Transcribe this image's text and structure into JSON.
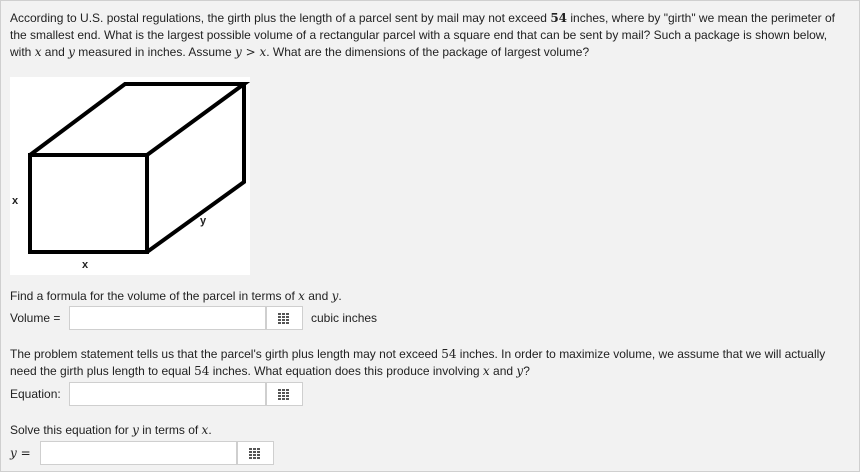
{
  "intro": {
    "t1": "According to U.S. postal regulations, the girth plus the length of a parcel sent by mail may not exceed ",
    "n1": "54",
    "t2": " inches, where by \"girth\" we mean the perimeter of the smallest end. What is the largest possible volume of a rectangular parcel with a square end that can be sent by mail? Such a package is shown below, with ",
    "x": "x",
    "t3": " and ",
    "y": "y",
    "t4": " measured in inches. Assume ",
    "cmp": "y > x",
    "t5": ". What are the dimensions of the package of largest volume?"
  },
  "figure": {
    "label_x_side": "x",
    "label_x_bottom": "x",
    "label_y": "y"
  },
  "q1": {
    "prompt_a": "Find a formula for the volume of the parcel in terms of ",
    "x": "x",
    "mid": " and ",
    "y": "y",
    "end": ".",
    "field_label": "Volume =",
    "value": "",
    "unit": "cubic inches",
    "grid_icon": "grid-icon"
  },
  "q2": {
    "t1": "The problem statement tells us that the parcel's girth plus length may not exceed ",
    "n1": "54",
    "t2": " inches. In order to maximize volume, we assume that we will actually need the girth plus length to equal ",
    "n2": "54",
    "t3": " inches. What equation does this produce involving ",
    "x": "x",
    "mid": " and ",
    "y": "y",
    "end": "?",
    "field_label": "Equation:",
    "value": "",
    "grid_icon": "grid-icon"
  },
  "q3": {
    "prompt_a": "Solve this equation for ",
    "y": "y",
    "mid": " in terms of ",
    "x": "x",
    "end": ".",
    "field_label": "y =",
    "value": "",
    "grid_icon": "grid-icon"
  }
}
